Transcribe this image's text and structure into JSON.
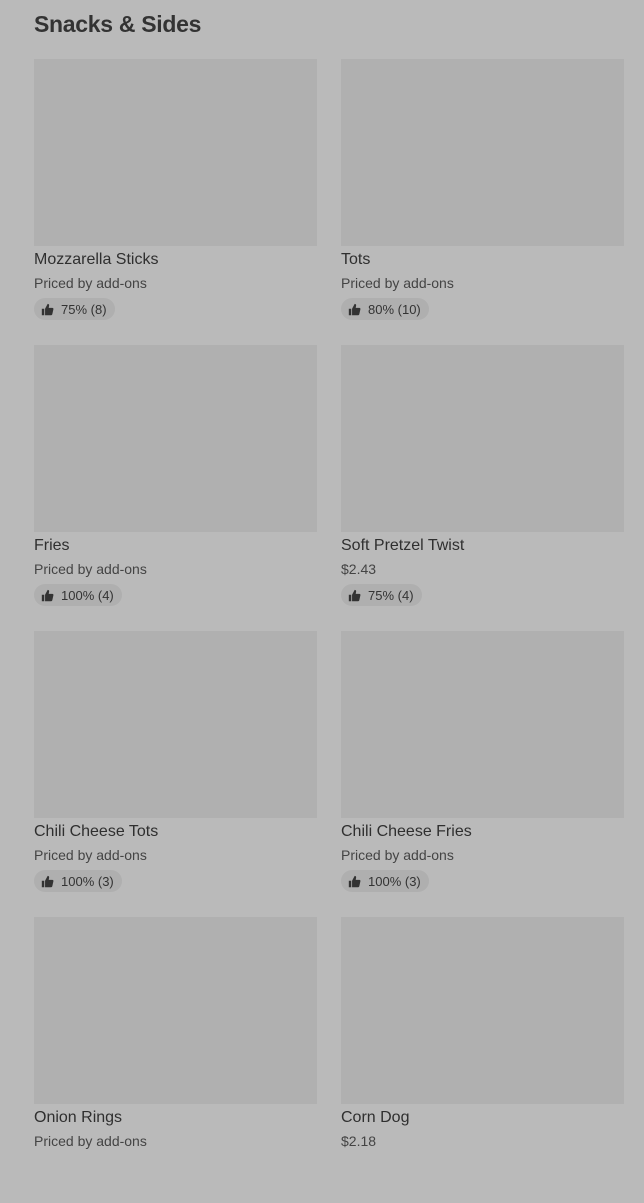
{
  "section": {
    "title": "Snacks & Sides"
  },
  "items": [
    {
      "name": "Mozzarella Sticks",
      "price": "Priced by add-ons",
      "rating": "75% (8)",
      "icon": "thumbs-up-icon"
    },
    {
      "name": "Tots",
      "price": "Priced by add-ons",
      "rating": "80% (10)",
      "icon": "thumbs-up-icon"
    },
    {
      "name": "Fries",
      "price": "Priced by add-ons",
      "rating": "100% (4)",
      "icon": "thumbs-up-icon"
    },
    {
      "name": "Soft Pretzel Twist",
      "price": "$2.43",
      "rating": "75% (4)",
      "icon": "thumbs-up-icon"
    },
    {
      "name": "Chili Cheese Tots",
      "price": "Priced by add-ons",
      "rating": "100% (3)",
      "icon": "thumbs-up-icon"
    },
    {
      "name": "Chili Cheese Fries",
      "price": "Priced by add-ons",
      "rating": "100% (3)",
      "icon": "thumbs-up-icon"
    },
    {
      "name": "Onion Rings",
      "price": "Priced by add-ons",
      "icon": "thumbs-up-icon"
    },
    {
      "name": "Corn Dog",
      "price": "$2.18",
      "icon": "thumbs-up-icon"
    }
  ]
}
